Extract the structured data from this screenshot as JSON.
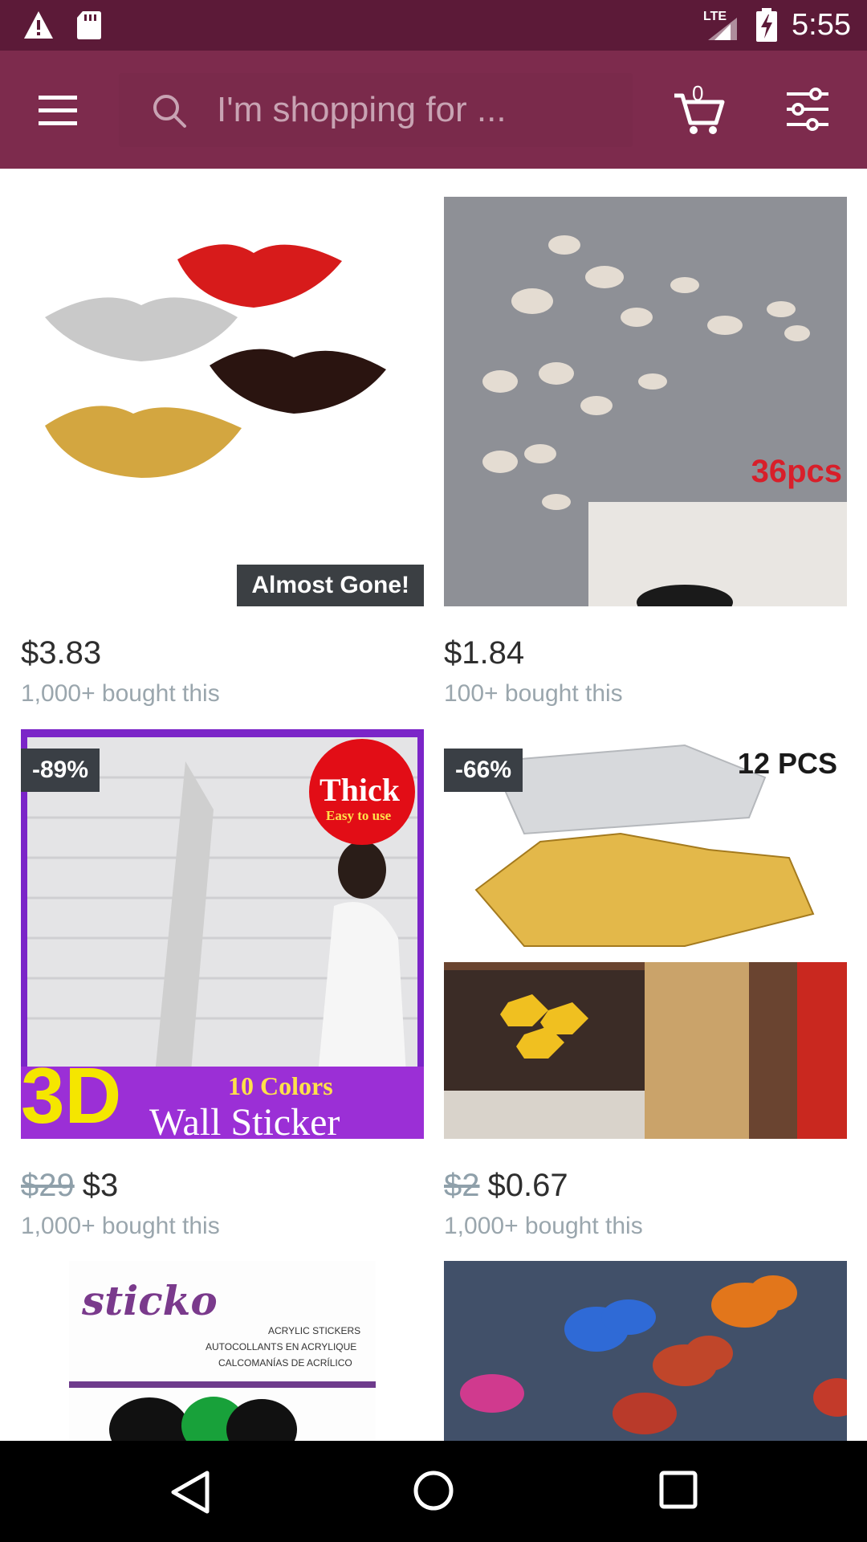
{
  "status_bar": {
    "time": "5:55",
    "network": "LTE",
    "icons": [
      "warning-icon",
      "sd-card-icon",
      "signal-icon",
      "battery-charging-icon"
    ]
  },
  "header": {
    "search_placeholder": "I'm shopping for ...",
    "cart_count": "0",
    "icons": [
      "menu-icon",
      "search-icon",
      "cart-icon",
      "filter-sliders-icon"
    ]
  },
  "products": [
    {
      "image_desc": "lips-mirror-stickers",
      "badge": "Almost Gone!",
      "old_price": "",
      "price": "$3.83",
      "bought": "1,000+ bought this"
    },
    {
      "image_desc": "butterfly-wall-stickers",
      "image_text": "36pcs",
      "old_price": "",
      "price": "$1.84",
      "bought": "100+ bought this"
    },
    {
      "image_desc": "3d-brick-wall-sticker",
      "discount": "-89%",
      "image_text_1": "Thick",
      "image_text_2": "Easy to use",
      "image_text_3": "3D",
      "image_text_4": "10 Colors",
      "image_text_5": "Wall Sticker",
      "old_price": "$29",
      "price": "$3",
      "bought": "1,000+ bought this"
    },
    {
      "image_desc": "hexagon-mirror-stickers",
      "discount": "-66%",
      "image_text": "12 PCS",
      "old_price": "$2",
      "price": "$0.67",
      "bought": "1,000+ bought this"
    },
    {
      "image_desc": "sticko-acrylic-stickers",
      "image_text_1": "sticko",
      "image_text_2": "ACRYLIC STICKERS",
      "image_text_3": "AUTOCOLLANTS EN ACRYLIQUE",
      "image_text_4": "CALCOMANÍAS DE ACRÍLICO"
    },
    {
      "image_desc": "led-butterfly-lights"
    }
  ],
  "nav": {
    "icons": [
      "back-icon",
      "home-icon",
      "recents-icon"
    ]
  },
  "colors": {
    "status_bar": "#5c1a38",
    "app_bar": "#7d2b4d",
    "badge": "#3a3f45",
    "price": "#2e2e2e",
    "muted": "#9aa6ad"
  }
}
